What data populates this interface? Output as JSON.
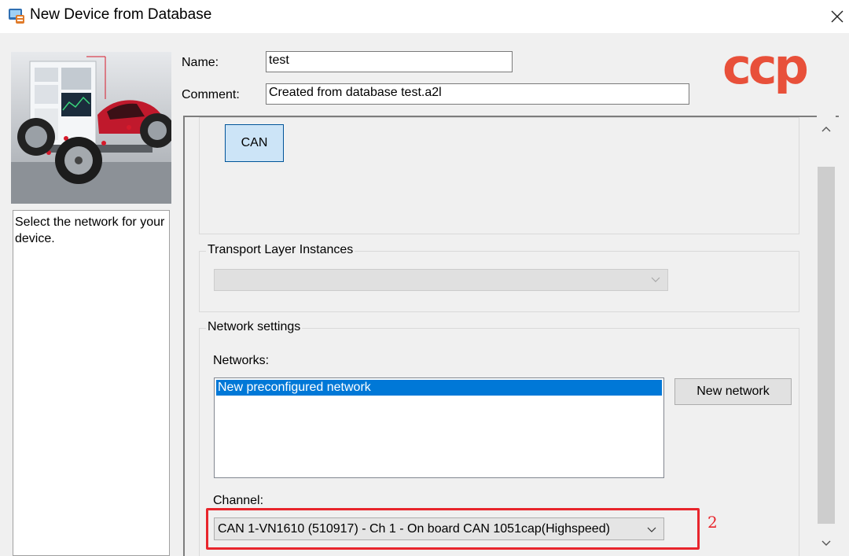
{
  "window": {
    "title": "New Device from Database",
    "icons": {
      "app": "device-database-icon",
      "close": "close-icon"
    }
  },
  "sidebar": {
    "description": "Select the network for your device."
  },
  "header": {
    "name_label": "Name:",
    "name_value": "test",
    "comment_label": "Comment:",
    "comment_value": "Created from database test.a2l",
    "logo_text": "ccp"
  },
  "network_type": {
    "selected_button": "CAN"
  },
  "transport_layer": {
    "legend": "Transport Layer Instances",
    "selected_value": ""
  },
  "network_settings": {
    "legend": "Network settings",
    "networks_label": "Networks:",
    "networks": [
      "New preconfigured network"
    ],
    "new_network_button": "New network",
    "channel_label": "Channel:",
    "channel_value": "CAN 1-VN1610 (510917) - Ch 1 - On board CAN 1051cap(Highspeed)"
  },
  "annotation": {
    "number": "2",
    "color": "#e8252c"
  },
  "colors": {
    "selection": "#0078d7",
    "can_button_bg": "#cce4f7",
    "logo_red": "#e8503a",
    "logo_gray": "#6e6e6e"
  }
}
